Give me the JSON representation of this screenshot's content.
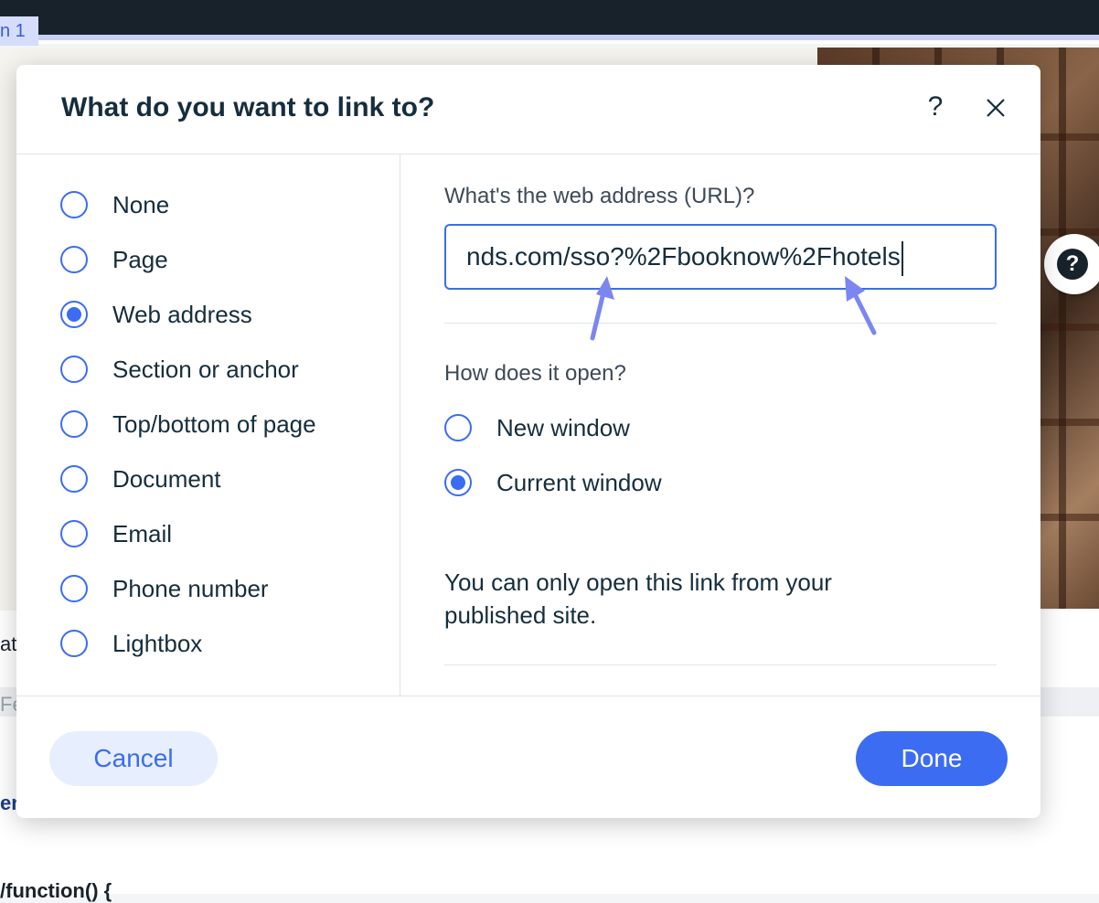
{
  "background": {
    "page_tag": "n 1",
    "fragments": [
      "att",
      "Fe",
      "en",
      "/function() {"
    ]
  },
  "dialog": {
    "title": "What do you want to link to?",
    "help_label": "?",
    "link_types": [
      {
        "label": "None",
        "selected": false
      },
      {
        "label": "Page",
        "selected": false
      },
      {
        "label": "Web address",
        "selected": true
      },
      {
        "label": "Section or anchor",
        "selected": false
      },
      {
        "label": "Top/bottom of page",
        "selected": false
      },
      {
        "label": "Document",
        "selected": false
      },
      {
        "label": "Email",
        "selected": false
      },
      {
        "label": "Phone number",
        "selected": false
      },
      {
        "label": "Lightbox",
        "selected": false
      }
    ],
    "url_label": "What's the web address (URL)?",
    "url_value": "nds.com/sso?%2Fbooknow%2Fhotels",
    "open_label": "How does it open?",
    "open_options": [
      {
        "label": "New window",
        "selected": false
      },
      {
        "label": "Current window",
        "selected": true
      }
    ],
    "info_text": "You can only open this link from your published site.",
    "cancel_label": "Cancel",
    "done_label": "Done"
  },
  "colors": {
    "accent": "#3b6cf2",
    "annotation_arrow": "#7b86f0",
    "text": "#162d3d"
  },
  "icons": [
    "close-icon",
    "question-icon",
    "annotation-arrow-icon"
  ]
}
